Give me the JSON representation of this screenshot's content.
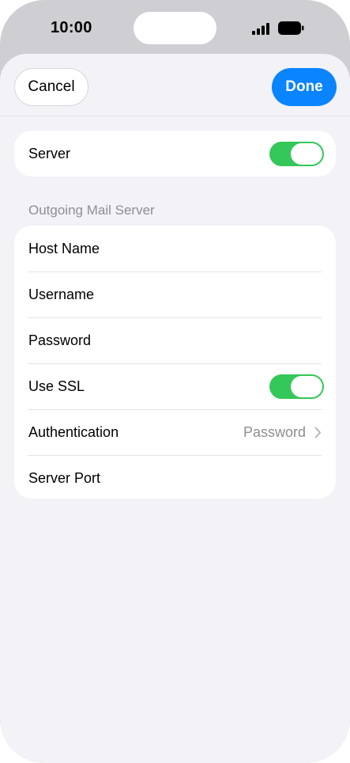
{
  "status_bar": {
    "time": "10:00"
  },
  "toolbar": {
    "cancel_label": "Cancel",
    "done_label": "Done"
  },
  "server_row": {
    "label": "Server",
    "toggle_on": true
  },
  "outgoing": {
    "header": "Outgoing Mail Server",
    "rows": [
      {
        "label": "Host Name"
      },
      {
        "label": "Username"
      },
      {
        "label": "Password"
      },
      {
        "label": "Use SSL",
        "toggle_on": true
      },
      {
        "label": "Authentication",
        "value": "Password"
      },
      {
        "label": "Server Port"
      }
    ]
  },
  "colors": {
    "accent": "#0a84ff",
    "toggle_on": "#34c759",
    "secondary_text": "#8e8e93",
    "background": "#f2f2f7"
  },
  "icons": {
    "signal": "cellular-signal-icon",
    "battery": "battery-icon",
    "chevron": "chevron-right-icon"
  }
}
